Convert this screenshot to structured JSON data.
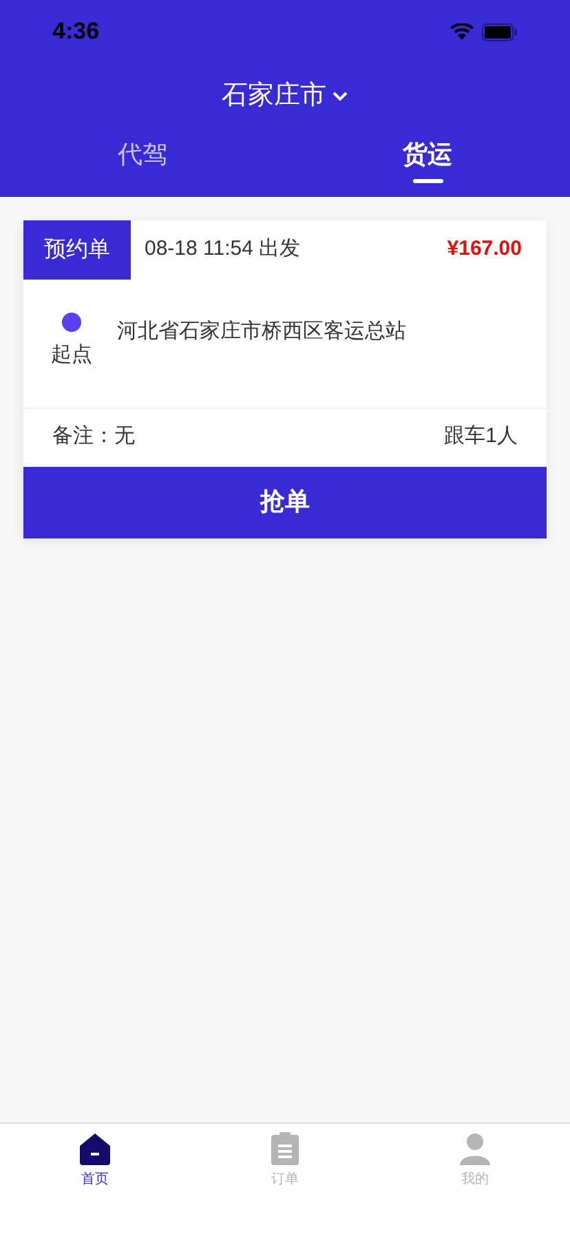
{
  "status_bar": {
    "time": "4:36"
  },
  "header": {
    "city": "石家庄市"
  },
  "tabs": [
    {
      "label": "代驾",
      "selected": false
    },
    {
      "label": "货运",
      "selected": true
    }
  ],
  "orders": [
    {
      "type_label": "预约单",
      "departure": "08-18 11:54 出发",
      "price": "¥167.00",
      "start_label": "起点",
      "start_address": "河北省石家庄市桥西区客运总站",
      "note": "备注：无",
      "passengers": "跟车1人",
      "action": "抢单"
    }
  ],
  "bottom_nav": [
    {
      "kind": "home",
      "label": "首页",
      "selected": true
    },
    {
      "kind": "orders",
      "label": "订单",
      "selected": false
    },
    {
      "kind": "profile",
      "label": "我的",
      "selected": false
    }
  ]
}
